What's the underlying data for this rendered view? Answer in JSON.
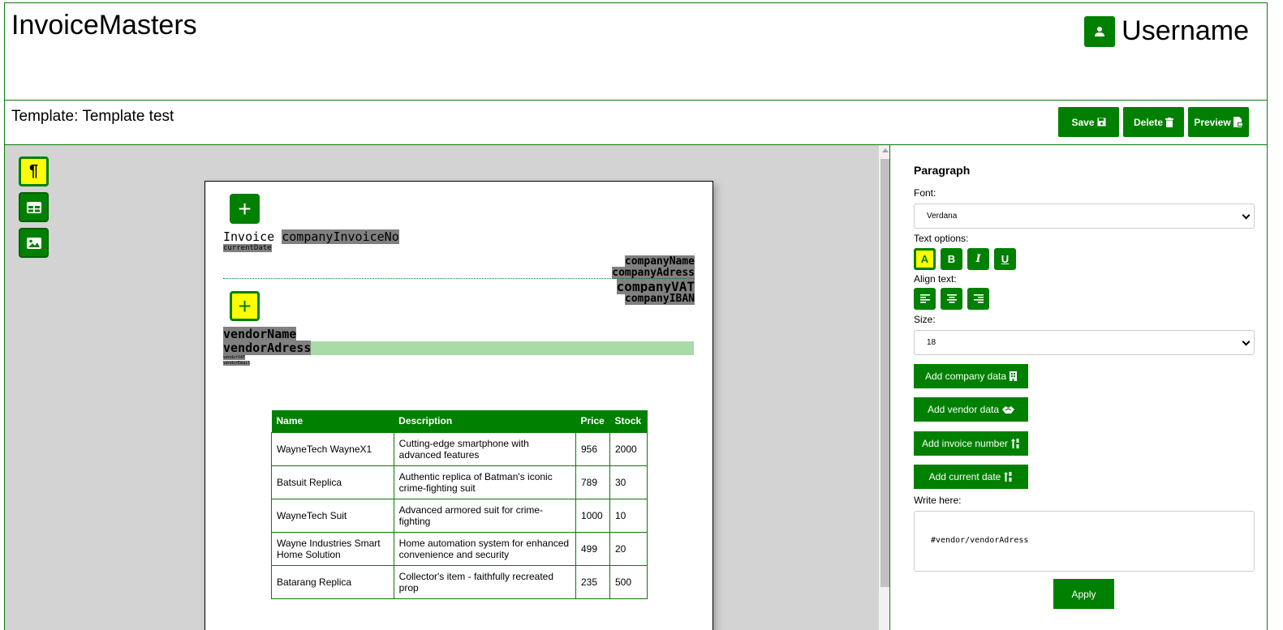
{
  "header": {
    "app_title": "InvoiceMasters",
    "username": "Username",
    "user_icon": "user-icon"
  },
  "toolbar": {
    "template_prefix": "Template: ",
    "template_name": "Template test",
    "save_label": "Save",
    "delete_label": "Delete",
    "preview_label": "Preview"
  },
  "tools": [
    {
      "name": "paragraph",
      "icon": "paragraph-icon",
      "active": true
    },
    {
      "name": "table",
      "icon": "table-icon",
      "active": false
    },
    {
      "name": "image",
      "icon": "image-icon",
      "active": false
    }
  ],
  "paper": {
    "invoice_label": "Invoice",
    "invoice_no": "companyInvoiceNo",
    "current_date": "currentDate",
    "company": [
      "companyName",
      "companyAdress",
      "companyVAT",
      "companyIBAN"
    ],
    "vendor": [
      "vendorName",
      "vendorAdress"
    ],
    "vendor_small": [
      "vendorVAT",
      "vendorEmail"
    ],
    "table": {
      "headers": [
        "Name",
        "Description",
        "Price",
        "Stock"
      ],
      "rows": [
        [
          "WayneTech WayneX1",
          "Cutting-edge smartphone with advanced features",
          "956",
          "2000"
        ],
        [
          "Batsuit Replica",
          "Authentic replica of Batman's iconic crime-fighting suit",
          "789",
          "30"
        ],
        [
          "WayneTech Suit",
          "Advanced armored suit for crime-fighting",
          "1000",
          "10"
        ],
        [
          "Wayne Industries Smart Home Solution",
          "Home automation system for enhanced convenience and security",
          "499",
          "20"
        ],
        [
          "Batarang Replica",
          "Collector's item - faithfully recreated prop",
          "235",
          "500"
        ]
      ]
    }
  },
  "panel": {
    "title": "Paragraph",
    "font_label": "Font:",
    "font_value": "Verdana",
    "text_options_label": "Text options:",
    "text_options": [
      "A",
      "B",
      "I",
      "U"
    ],
    "align_label": "Align text:",
    "size_label": "Size:",
    "size_value": "18",
    "add_company": "Add company data",
    "add_vendor": "Add vendor data",
    "add_invoice_number": "Add invoice number",
    "add_current_date": "Add current date",
    "write_label": "Write here:",
    "write_value": "#vendor/vendorAdress",
    "apply_label": "Apply"
  },
  "colors": {
    "accent": "#008000",
    "highlight": "#ffff00",
    "placeholder": "#808080",
    "selection": "#a9dba9"
  }
}
